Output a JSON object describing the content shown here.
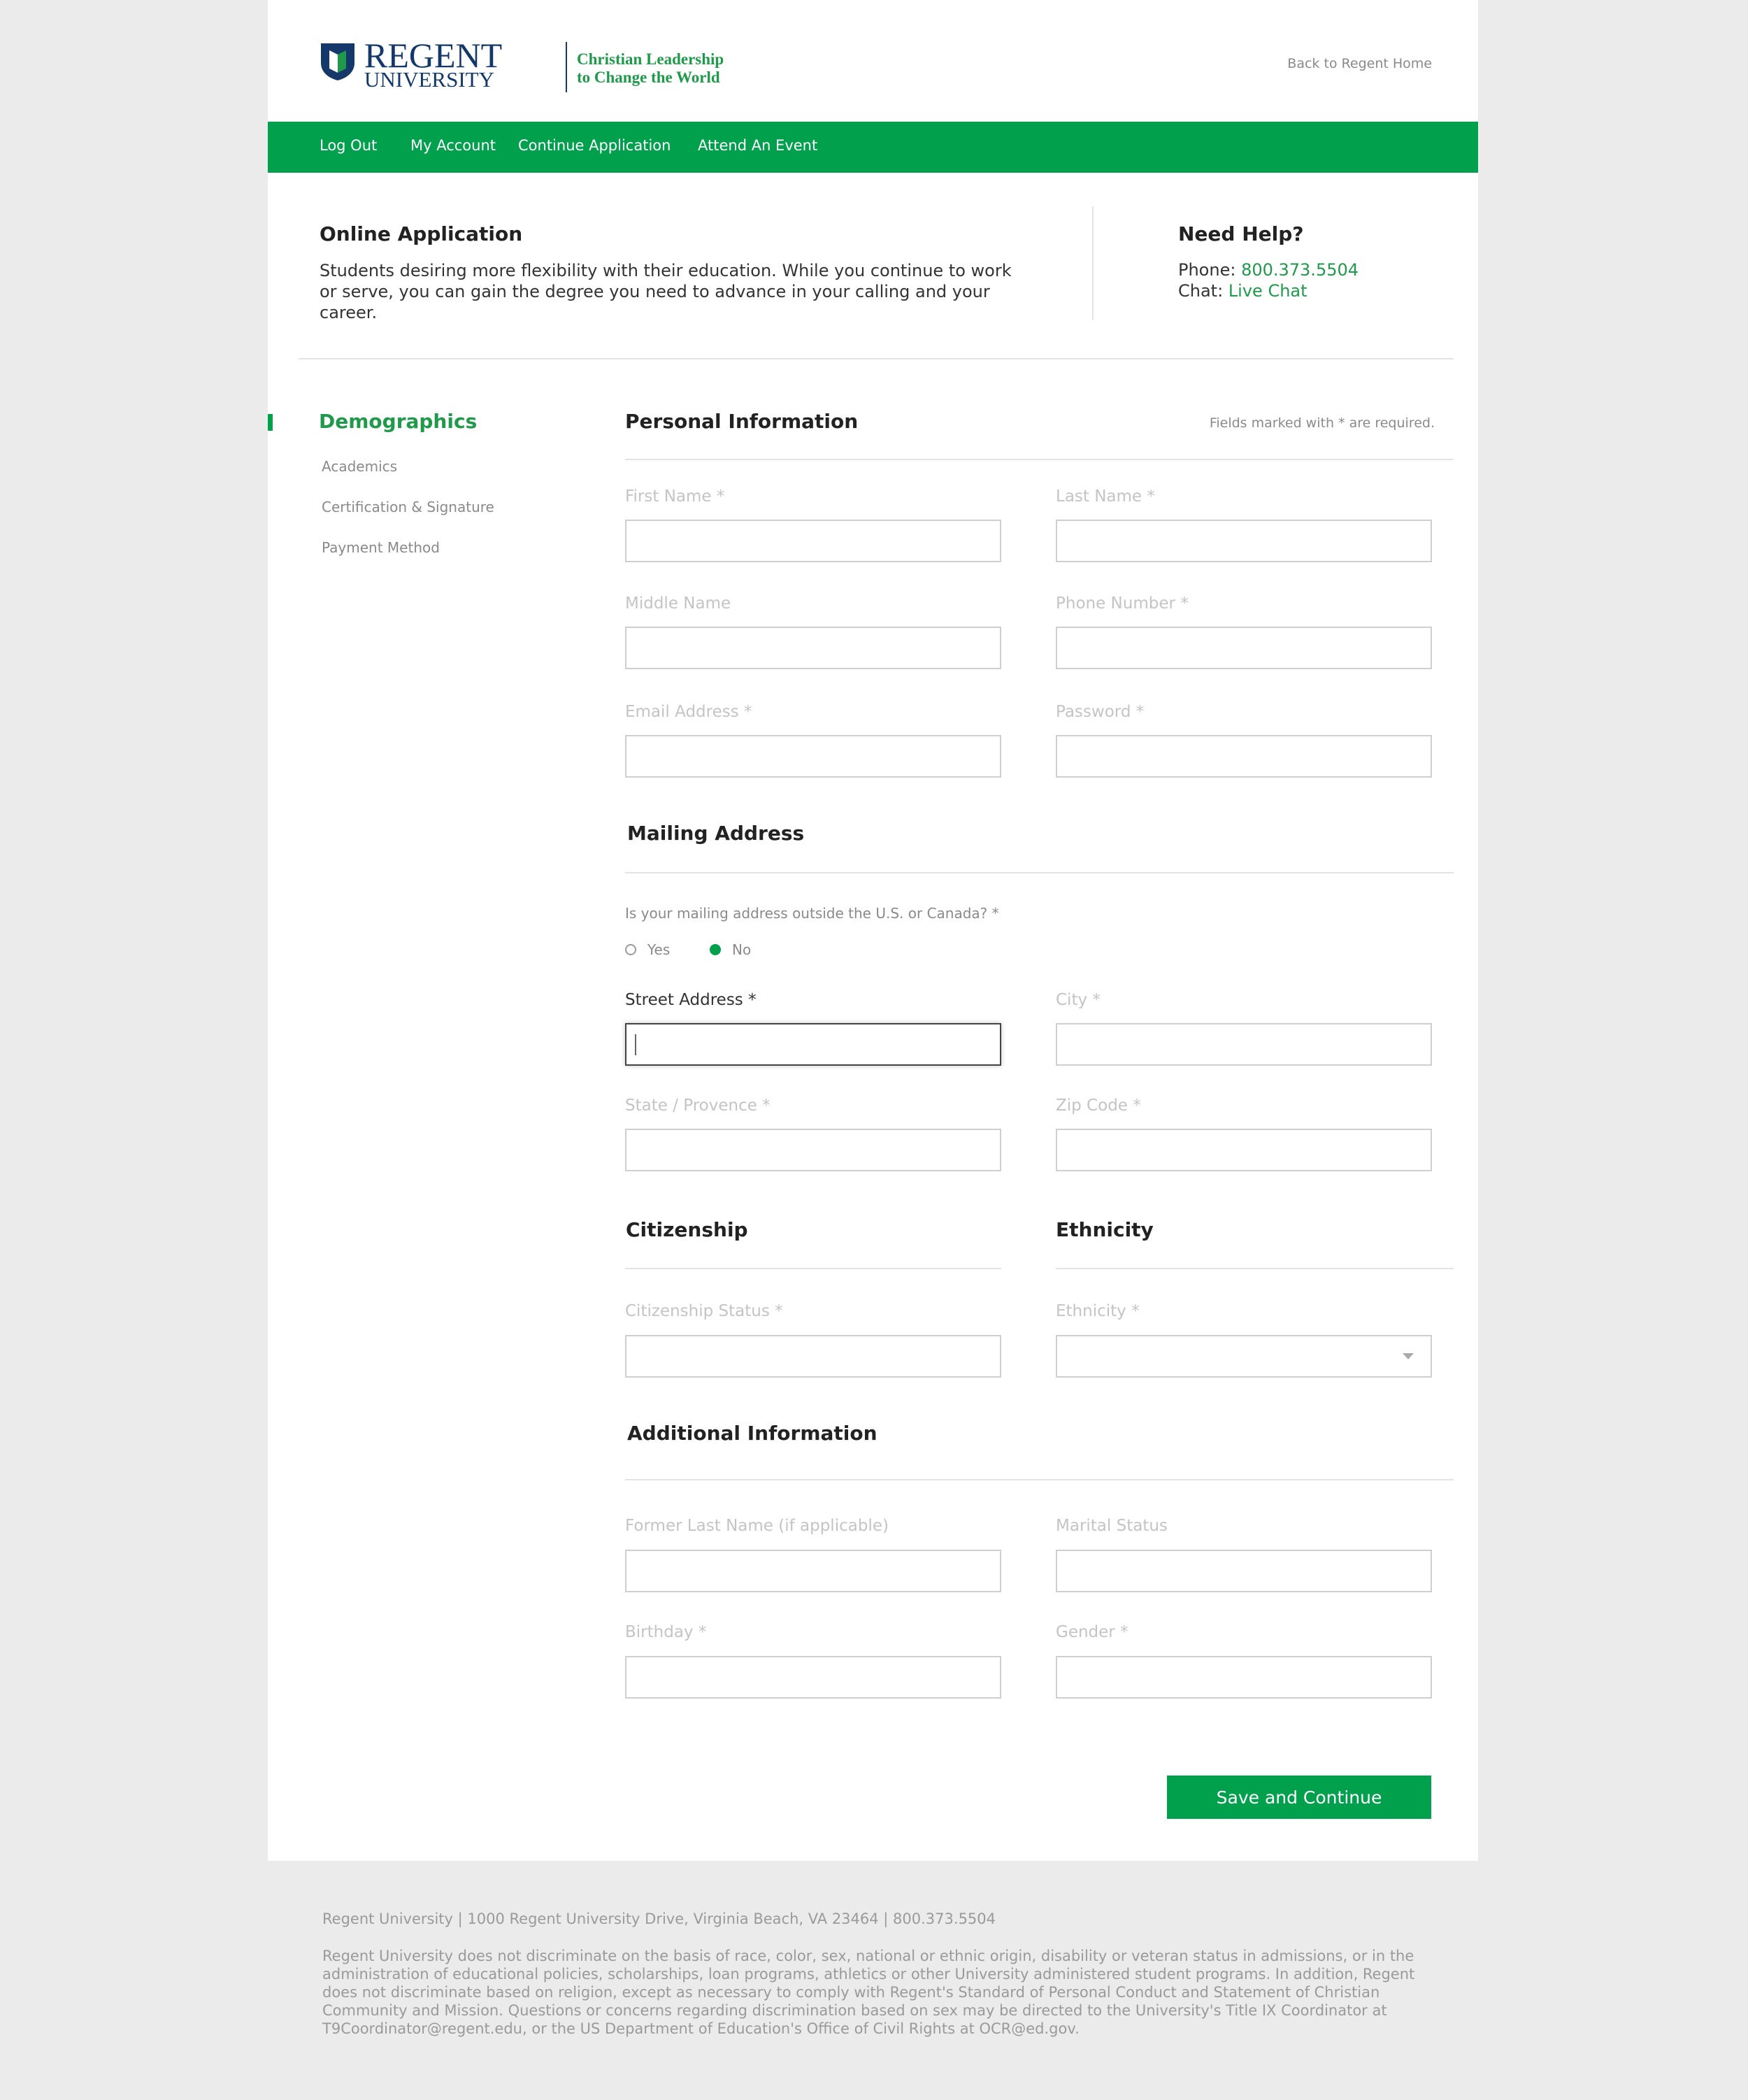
{
  "header": {
    "logo_regent": "REGENT",
    "logo_university": "UNIVERSITY",
    "logo_tagline_1": "Christian Leadership",
    "logo_tagline_2": "to Change the World",
    "back_home": "Back to Regent Home"
  },
  "nav": {
    "items": [
      {
        "label": "Log Out"
      },
      {
        "label": "My Account"
      },
      {
        "label": "Continue Application"
      },
      {
        "label": "Attend An Event"
      }
    ]
  },
  "intro": {
    "title": "Online Application",
    "text": "Students desiring more flexibility with their education. While you continue to work or serve, you can gain the degree you need to advance in your calling and your career."
  },
  "help": {
    "title": "Need Help?",
    "phone_label": "Phone: ",
    "phone": "800.373.5504",
    "chat_label": "Chat: ",
    "chat": "Live Chat"
  },
  "sidebar": {
    "active": "Demographics",
    "items": [
      {
        "label": "Academics"
      },
      {
        "label": "Certification & Signature"
      },
      {
        "label": "Payment Method"
      }
    ]
  },
  "form": {
    "required_note": "Fields marked with * are required.",
    "personal": {
      "title": "Personal Information",
      "first_name": {
        "label": "First Name *",
        "value": ""
      },
      "last_name": {
        "label": "Last Name *",
        "value": ""
      },
      "middle_name": {
        "label": "Middle Name",
        "value": ""
      },
      "phone": {
        "label": "Phone Number *",
        "value": ""
      },
      "email": {
        "label": "Email Address *",
        "value": ""
      },
      "password": {
        "label": "Password *",
        "value": ""
      }
    },
    "mailing": {
      "title": "Mailing Address",
      "question": "Is your mailing address outside the U.S. or Canada? *",
      "radio_yes": "Yes",
      "radio_no": "No",
      "selected": "No",
      "street": {
        "label": "Street Address *",
        "value": ""
      },
      "city": {
        "label": "City *",
        "value": ""
      },
      "state": {
        "label": "State / Provence *",
        "value": ""
      },
      "zip": {
        "label": "Zip Code *",
        "value": ""
      }
    },
    "citizenship": {
      "title": "Citizenship",
      "status": {
        "label": "Citizenship Status *",
        "value": ""
      }
    },
    "ethnicity": {
      "title": "Ethnicity",
      "select": {
        "label": "Ethnicity *",
        "value": ""
      }
    },
    "additional": {
      "title": "Additional Information",
      "former_last": {
        "label": "Former Last Name (if applicable)",
        "value": ""
      },
      "marital": {
        "label": "Marital Status",
        "value": ""
      },
      "birthday": {
        "label": "Birthday *",
        "value": ""
      },
      "gender": {
        "label": "Gender *",
        "value": ""
      }
    },
    "submit_label": "Save and Continue"
  },
  "footer": {
    "address": "Regent University | 1000 Regent University Drive, Virginia Beach, VA 23464 | 800.373.5504",
    "legal": "Regent University does not discriminate on the basis of race, color, sex, national or ethnic origin, disability or veteran status in admissions, or in the administration of educational policies, scholarships, loan programs, athletics or other University administered student programs. In addition, Regent does not discriminate based on religion, except as necessary to comply with Regent's Standard of Personal Conduct and Statement of Christian Community and Mission. Questions or concerns regarding discrimination based on sex may be directed to the University's Title IX Coordinator at T9Coordinator@regent.edu, or the US Department of Education's Office of Civil Rights at OCR@ed.gov."
  },
  "colors": {
    "brand_green": "#00a04d",
    "link_green": "#1f9a4b",
    "logo_navy": "#14386a",
    "page_bg": "#ebebeb"
  }
}
